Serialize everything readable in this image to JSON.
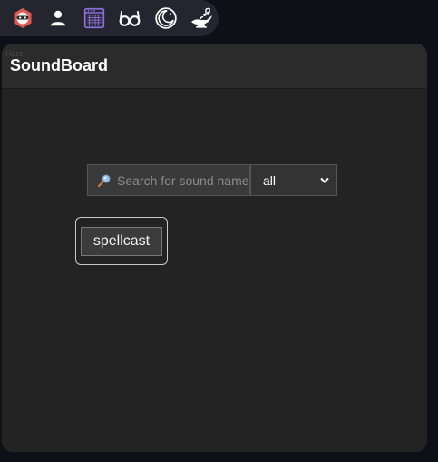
{
  "toolbar": {
    "icons": [
      {
        "name": "mask-avatar-icon",
        "color": "#e05a4f"
      },
      {
        "name": "user-icon",
        "color": "#ffffff"
      },
      {
        "name": "amplifier-icon",
        "color": "#8a6fd6"
      },
      {
        "name": "glasses-icon",
        "color": "#ffffff"
      },
      {
        "name": "moon-clock-icon",
        "color": "#ffffff"
      },
      {
        "name": "genie-lamp-icon",
        "color": "#ffffff"
      }
    ]
  },
  "panel": {
    "ghost_label": "Here",
    "title": "SoundBoard"
  },
  "search": {
    "placeholder": "Search for sound name",
    "value": ""
  },
  "filter": {
    "selected": "all"
  },
  "sounds": [
    {
      "label": "spellcast"
    }
  ],
  "colors": {
    "background": "#0f0f17",
    "panel": "#232323",
    "header": "#2b2b2b",
    "accent_purple": "#8a6fd6"
  }
}
